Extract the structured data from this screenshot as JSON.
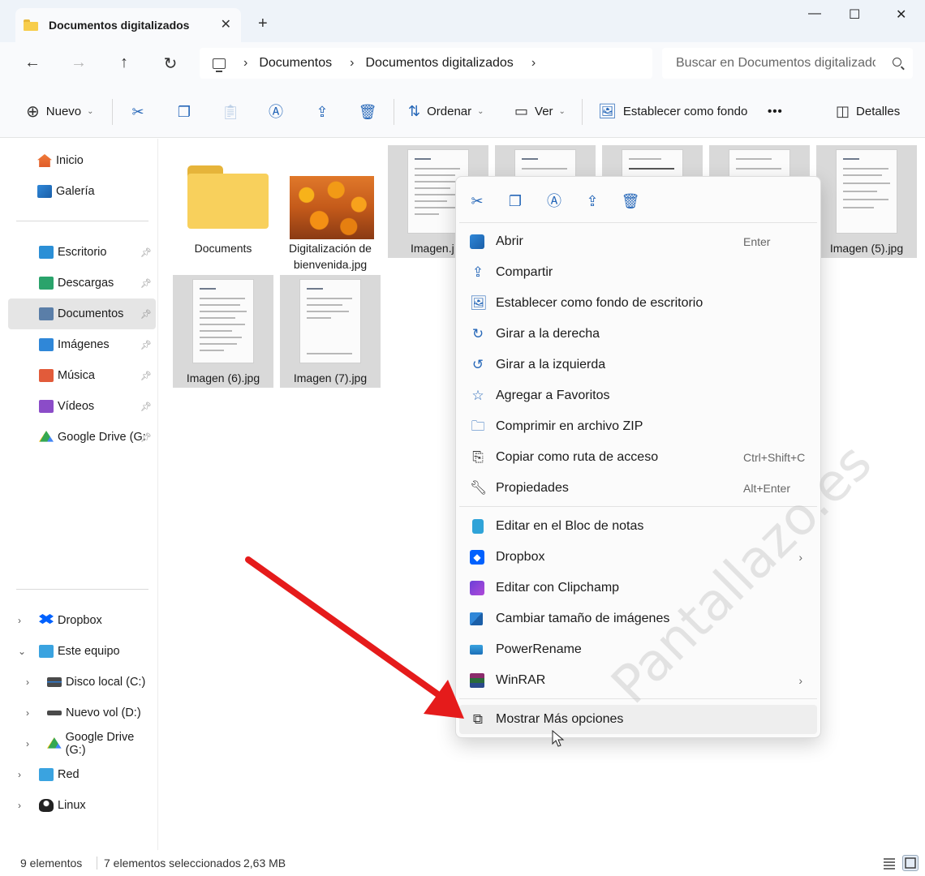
{
  "window": {
    "tab_title": "Documentos digitalizados",
    "tab_close": "✕",
    "new_tab": "+",
    "minimize": "—",
    "maximize": "☐",
    "close": "✕"
  },
  "address": {
    "back": "←",
    "forward": "→",
    "up": "↑",
    "refresh": "↻",
    "breadcrumb": [
      "Documentos",
      "Documentos digitalizados"
    ],
    "sep": "›",
    "search_placeholder": "Buscar en Documentos digitalizados"
  },
  "toolbar": {
    "new_label": "Nuevo",
    "sort_label": "Ordenar",
    "view_label": "Ver",
    "wallpaper_label": "Establecer como fondo",
    "more": "•••",
    "details_label": "Detalles",
    "chev": "⌄"
  },
  "sidebar": {
    "quick": [
      {
        "label": "Inicio",
        "icon": "home-icon"
      },
      {
        "label": "Galería",
        "icon": "gallery-icon"
      }
    ],
    "pinned": [
      {
        "label": "Escritorio",
        "icon": "desktop-icon",
        "color": "#2b8fd6"
      },
      {
        "label": "Descargas",
        "icon": "downloads-icon",
        "color": "#2aa36b"
      },
      {
        "label": "Documentos",
        "icon": "documents-icon",
        "color": "#5a7ea8"
      },
      {
        "label": "Imágenes",
        "icon": "pictures-icon",
        "color": "#2f87d8"
      },
      {
        "label": "Música",
        "icon": "music-icon",
        "color": "#e25b3a"
      },
      {
        "label": "Vídeos",
        "icon": "videos-icon",
        "color": "#8b4cc8"
      },
      {
        "label": "Google Drive (G:",
        "icon": "google-drive-icon",
        "color": "#34a853"
      }
    ],
    "tree": [
      {
        "label": "Dropbox",
        "icon": "dropbox-icon",
        "expander": "›"
      },
      {
        "label": "Este equipo",
        "icon": "this-pc-icon",
        "expander": "⌄"
      },
      {
        "label": "Disco local (C:)",
        "icon": "drive-c-icon",
        "expander": "›"
      },
      {
        "label": "Nuevo vol (D:)",
        "icon": "drive-d-icon",
        "expander": "›"
      },
      {
        "label": "Google Drive (G:)",
        "icon": "google-drive-icon",
        "expander": "›"
      },
      {
        "label": "Red",
        "icon": "network-icon",
        "expander": "›"
      },
      {
        "label": "Linux",
        "icon": "linux-icon",
        "expander": "›"
      }
    ]
  },
  "files": [
    {
      "label": "Documents",
      "type": "folder"
    },
    {
      "label": "Digitalización de bienvenida.jpg",
      "type": "photo"
    },
    {
      "label": "Imagen.jpg",
      "type": "doc"
    },
    {
      "label": "Imagen (5).jpg",
      "type": "doc"
    },
    {
      "label": "Imagen (6).jpg",
      "type": "doc"
    },
    {
      "label": "Imagen (7).jpg",
      "type": "doc"
    }
  ],
  "files_visible_labels": {
    "folder": "Documents",
    "photo_line1": "Digitalización de",
    "photo_line2": "bienvenida.jpg",
    "img1": "Imagen.j",
    "img5": "Imagen (5).jpg",
    "img6": "Imagen (6).jpg",
    "img7": "Imagen (7).jpg"
  },
  "context_menu": {
    "items": [
      {
        "label": "Abrir",
        "shortcut": "Enter",
        "icon": "open-icon"
      },
      {
        "label": "Compartir",
        "shortcut": "",
        "icon": "share-icon"
      },
      {
        "label": "Establecer como fondo de escritorio",
        "shortcut": "",
        "icon": "wallpaper-icon"
      },
      {
        "label": "Girar a la derecha",
        "shortcut": "",
        "icon": "rotate-right-icon"
      },
      {
        "label": "Girar a la izquierda",
        "shortcut": "",
        "icon": "rotate-left-icon"
      },
      {
        "label": "Agregar a Favoritos",
        "shortcut": "",
        "icon": "star-icon"
      },
      {
        "label": "Comprimir en archivo ZIP",
        "shortcut": "",
        "icon": "zip-icon"
      },
      {
        "label": "Copiar como ruta de acceso",
        "shortcut": "Ctrl+Shift+C",
        "icon": "copy-path-icon"
      },
      {
        "label": "Propiedades",
        "shortcut": "Alt+Enter",
        "icon": "wrench-icon"
      }
    ],
    "apps": [
      {
        "label": "Editar en el Bloc de notas",
        "icon": "notepad-icon",
        "submenu": false
      },
      {
        "label": "Dropbox",
        "icon": "dropbox-icon",
        "submenu": true
      },
      {
        "label": "Editar con Clipchamp",
        "icon": "clipchamp-icon",
        "submenu": false
      },
      {
        "label": "Cambiar tamaño de imágenes",
        "icon": "image-resizer-icon",
        "submenu": false
      },
      {
        "label": "PowerRename",
        "icon": "powerrename-icon",
        "submenu": false
      },
      {
        "label": "WinRAR",
        "icon": "winrar-icon",
        "submenu": true
      }
    ],
    "more_options": "Mostrar Más opciones",
    "submenu_glyph": "›"
  },
  "status": {
    "count": "9 elementos",
    "selected": "7 elementos seleccionados",
    "size": "2,63 MB"
  },
  "watermark": "Pantallazo.es",
  "colors": {
    "accent": "#2667b8",
    "arrow": "#e51b1b",
    "selection": "#d9d9d9"
  }
}
